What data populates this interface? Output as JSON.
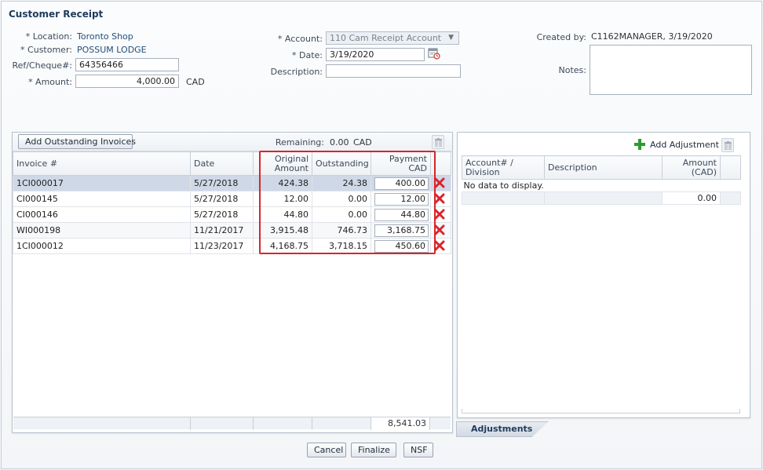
{
  "page": {
    "title": "Customer Receipt"
  },
  "form": {
    "location_label": "* Location:",
    "location_value": "Toronto Shop",
    "customer_label": "* Customer:",
    "customer_value": "POSSUM LODGE",
    "ref_label": "Ref/Cheque#:",
    "ref_value": "64356466",
    "amount_label": "* Amount:",
    "amount_value": "4,000.00",
    "amount_currency": "CAD",
    "account_label": "* Account:",
    "account_value": "110 Cam Receipt Account",
    "date_label": "* Date:",
    "date_value": "3/19/2020",
    "description_label": "Description:",
    "description_value": "",
    "created_by_label": "Created by:",
    "created_by_value": "C1162MANAGER, 3/19/2020",
    "notes_label": "Notes:",
    "notes_value": ""
  },
  "invoices": {
    "add_button": "Add Outstanding Invoices",
    "remaining_label": "Remaining:",
    "remaining_value": "0.00",
    "remaining_currency": "CAD",
    "columns": [
      "Invoice #",
      "Date",
      "Original Amount",
      "Outstanding",
      "Payment CAD"
    ],
    "rows": [
      {
        "invoice": "1CI000017",
        "date": "5/27/2018",
        "original": "424.38",
        "outstanding": "24.38",
        "payment": "400.00"
      },
      {
        "invoice": "CI000145",
        "date": "5/27/2018",
        "original": "12.00",
        "outstanding": "0.00",
        "payment": "12.00"
      },
      {
        "invoice": "CI000146",
        "date": "5/27/2018",
        "original": "44.80",
        "outstanding": "0.00",
        "payment": "44.80"
      },
      {
        "invoice": "WI000198",
        "date": "11/21/2017",
        "original": "3,915.48",
        "outstanding": "746.73",
        "payment": "3,168.75"
      },
      {
        "invoice": "1CI000012",
        "date": "11/23/2017",
        "original": "4,168.75",
        "outstanding": "3,718.15",
        "payment": "450.60"
      }
    ],
    "total_payment": "8,541.03"
  },
  "adjustments": {
    "add_button": "Add Adjustment",
    "columns": [
      "Account# / Division",
      "Description",
      "Amount (CAD)"
    ],
    "empty_text": "No data to display.",
    "total": "0.00",
    "tab_label": "Adjustments"
  },
  "actions": {
    "cancel": "Cancel",
    "finalize": "Finalize",
    "nsf": "NSF"
  },
  "colors": {
    "accent": "#1f4e79",
    "highlight": "#d9252a",
    "delete": "#d9252a",
    "add": "#2e9b2e"
  }
}
